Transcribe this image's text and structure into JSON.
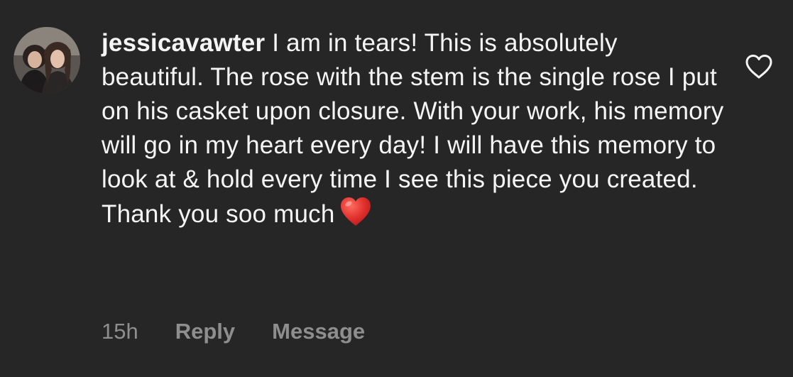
{
  "comment": {
    "username": "jessicavawter",
    "text": "I am in tears! This is absolutely beautiful. The rose with the stem is the single rose I put on his casket upon closure. With your work, his memory will go in my heart every day! I will have this memory to look at & hold every time I see this piece you created. Thank you soo much",
    "emoji_icon": "red-heart-icon",
    "time": "15h",
    "reply_label": "Reply",
    "message_label": "Message",
    "like_icon": "heart-outline-icon"
  },
  "colors": {
    "background": "#262626",
    "text": "#f5f5f5",
    "muted": "#8e8e8e",
    "heart": "#e0302c"
  }
}
